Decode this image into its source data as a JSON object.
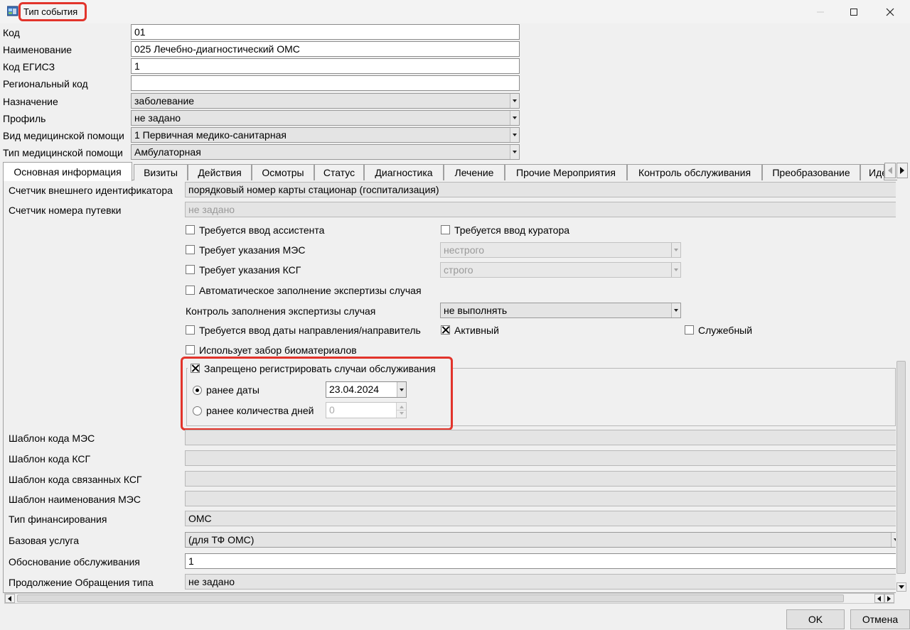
{
  "window": {
    "title": "Тип события",
    "maximize_icon": "maximize-icon",
    "close_icon": "close-icon",
    "minimize_icon": "minimize-icon"
  },
  "form": {
    "code_label": "Код",
    "code_value": "01",
    "name_label": "Наименование",
    "name_value": "025 Лечебно-диагностический ОМС",
    "egisz_label": "Код ЕГИСЗ",
    "egisz_value": "1",
    "regional_label": "Региональный код",
    "regional_value": "",
    "purpose_label": "Назначение",
    "purpose_value": "заболевание",
    "profile_label": "Профиль",
    "profile_value": "не задано",
    "care_kind_label": "Вид медицинской помощи",
    "care_kind_value": "1 Первичная медико-санитарная",
    "care_type_label": "Тип медицинской помощи",
    "care_type_value": "Амбулаторная"
  },
  "tabs": [
    {
      "label": "Основная информация",
      "active": true
    },
    {
      "label": "Визиты"
    },
    {
      "label": "Действия"
    },
    {
      "label": "Осмотры"
    },
    {
      "label": "Статус"
    },
    {
      "label": "Диагностика"
    },
    {
      "label": "Лечение"
    },
    {
      "label": "Прочие Мероприятия"
    },
    {
      "label": "Контроль обслуживания"
    },
    {
      "label": "Преобразование"
    },
    {
      "label": "Иде"
    }
  ],
  "main": {
    "ext_counter_label": "Счетчик внешнего идентификатора",
    "ext_counter_value": "порядковый номер карты стационар (госпитализация)",
    "voucher_counter_label": "Счетчик номера путевки",
    "voucher_counter_value": "не задано",
    "assistant_label": "Требуется ввод ассистента",
    "curator_label": "Требуется ввод куратора",
    "mes_label": "Требует указания МЭС",
    "mes_mode": "нестрого",
    "ksg_label": "Требует указания КСГ",
    "ksg_mode": "строго",
    "auto_expertise_label": "Автоматическое заполнение экспертизы случая",
    "expertise_control_label": "Контроль заполнения экспертизы случая",
    "expertise_control_value": "не выполнять",
    "referral_label": "Требуется ввод даты направления/направитель",
    "active_label": "Активный",
    "service_label": "Служебный",
    "biomaterial_label": "Использует забор биоматериалов",
    "forbid_label": "Запрещено регистрировать случаи обслуживания",
    "before_date_label": "ранее даты",
    "before_date_value": "23.04.2024",
    "before_days_label": "ранее количества дней",
    "before_days_value": "0",
    "mes_template_label": "Шаблон кода МЭС",
    "mes_template_value": "",
    "ksg_template_label": "Шаблон кода КСГ",
    "ksg_template_value": "",
    "related_ksg_label": "Шаблон кода связанных КСГ",
    "related_ksg_value": "",
    "mes_name_template_label": "Шаблон наименования МЭС",
    "mes_name_template_value": "",
    "finance_type_label": "Тип финансирования",
    "finance_type_value": "ОМС",
    "base_service_label": "Базовая услуга",
    "base_service_value": "(для ТФ ОМС)",
    "justification_label": "Обоснование обслуживания",
    "justification_value": "1",
    "continuation_label": "Продолжение Обращения типа",
    "continuation_value": "не задано"
  },
  "buttons": {
    "ok": "OK",
    "cancel": "Отмена"
  },
  "colors": {
    "highlight": "#e2342b",
    "window_bg": "#f0f0f0"
  }
}
